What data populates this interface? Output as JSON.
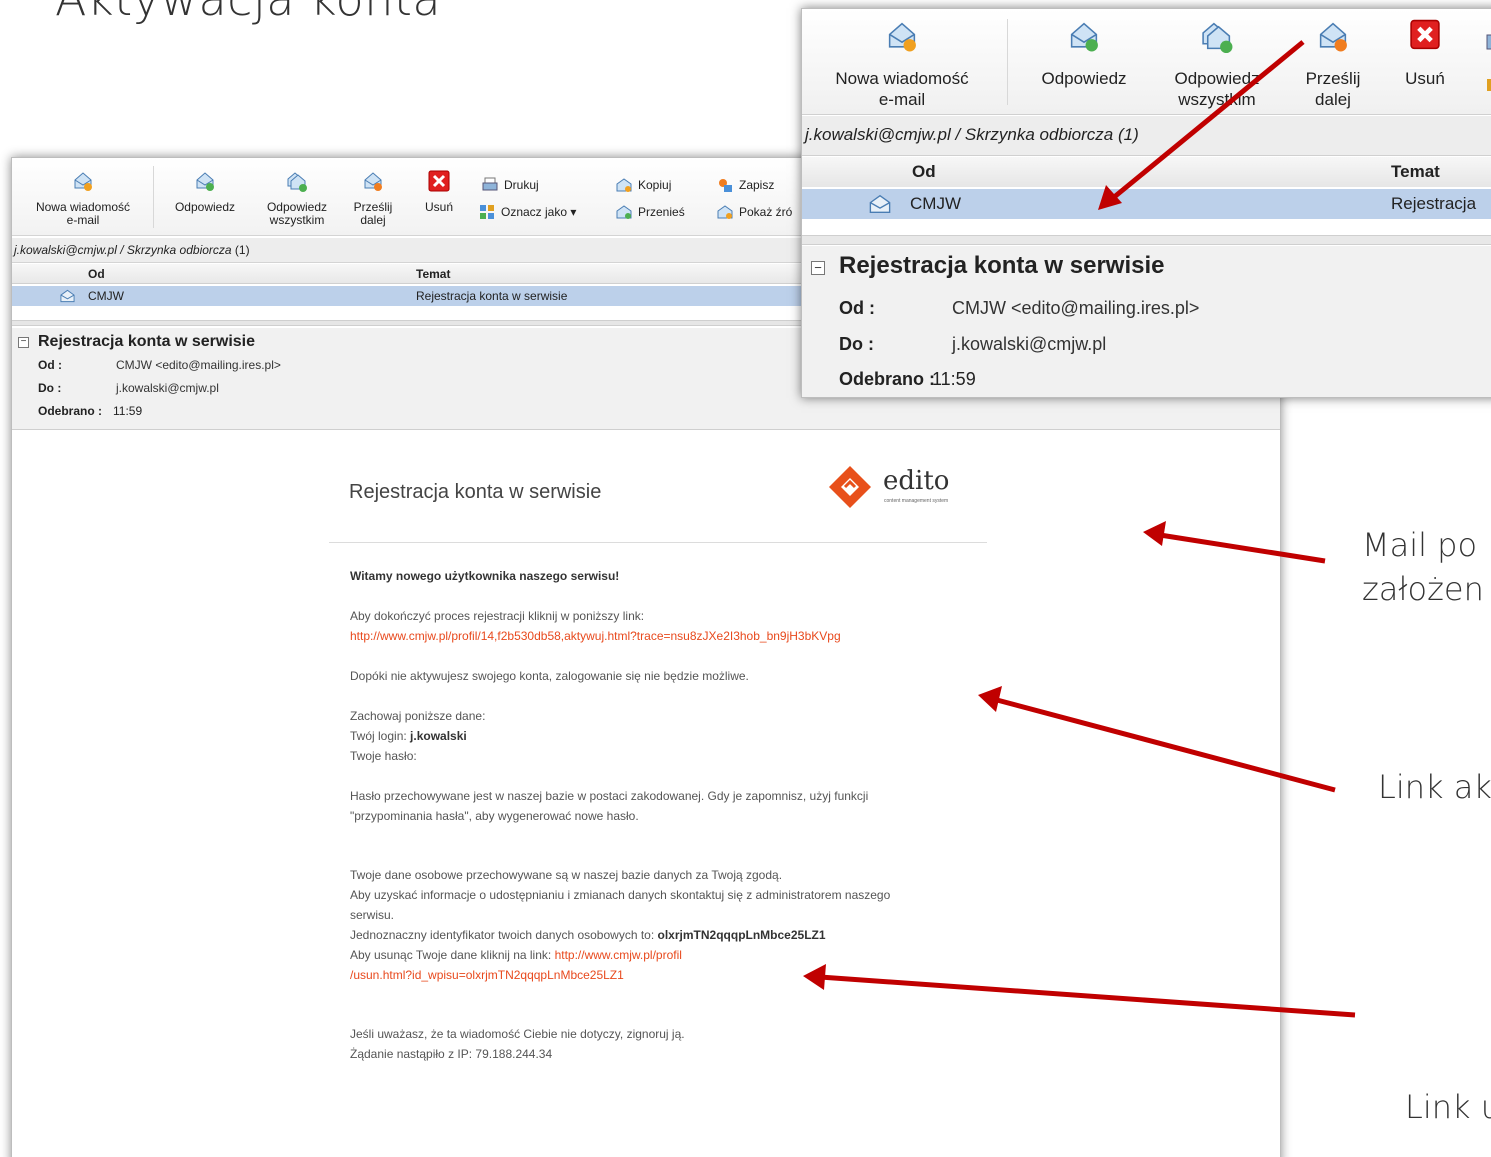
{
  "slide": {
    "title": "Aktywacja konta"
  },
  "toolbar": {
    "new_message": "Nowa wiadomość\ne-mail",
    "reply": "Odpowiedz",
    "reply_all": "Odpowiedz\nwszystkim",
    "forward": "Prześlij\ndalej",
    "delete": "Usuń",
    "print": "Drukuj",
    "mark_as": "Oznacz jako ▾",
    "copy": "Kopiuj",
    "move": "Przenieś",
    "save": "Zapisz",
    "show_source": "Pokaż źró"
  },
  "mailbox": {
    "path_account": "j.kowalski@cmjw.pl / Skrzynka odbiorcza",
    "path_count": " (1)",
    "col_from": "Od",
    "col_subject": "Temat",
    "row_from": "CMJW",
    "row_subject": "Rejestracja konta w serwisie",
    "zoom_row_subject": "Rejestracja"
  },
  "header": {
    "subject": "Rejestracja konta w serwisie",
    "from_label": "Od :",
    "from_value": "CMJW <edito@mailing.ires.pl>",
    "to_label": "Do :",
    "to_value": "j.kowalski@cmjw.pl",
    "received_label": "Odebrano :",
    "received_value": "11:59"
  },
  "email": {
    "title": "Rejestracja konta w serwisie",
    "logo_text": "edito",
    "logo_sub": "content management system",
    "greeting": "Witamy nowego użytkownika naszego serwisu!",
    "finish_text": "Aby dokończyć proces rejestracji kliknij w poniższy link:",
    "activation_link": "http://www.cmjw.pl/profil/14,f2b530db58,aktywuj.html?trace=nsu8zJXe2I3hob_bn9jH3bKVpg",
    "no_login": "Dopóki nie aktywujesz swojego konta, zalogowanie się nie będzie możliwe.",
    "keep_data": "Zachowaj poniższe dane:",
    "login_label": "Twój login: ",
    "login_value": "j.kowalski",
    "password_label": "Twoje hasło:",
    "password_info_1": "Hasło przechowywane jest w naszej bazie w postaci zakodowanej. Gdy je zapomnisz, użyj funkcji",
    "password_info_2": "\"przypominania hasła\", aby wygenerować nowe hasło.",
    "privacy_1": "Twoje dane osobowe przechowywane są w naszej bazie danych za Twoją zgodą.",
    "privacy_2": "Aby uzyskać informacje o udostępnianiu i zmianach danych skontaktuj się z administratorem naszego",
    "privacy_3": "serwisu.",
    "id_label": "Jednoznaczny identyfikator twoich danych osobowych to: ",
    "id_value": "olxrjmTN2qqqpLnMbce25LZ1",
    "remove_label": "Aby usunąc Twoje dane kliknij na link: ",
    "remove_link_1": "http://www.cmjw.pl/profil",
    "remove_link_2": "/usun.html?id_wpisu=olxrjmTN2qqqpLnMbce25LZ1",
    "ignore": "Jeśli uważasz, że ta wiadomość Ciebie nie dotyczy, zignoruj ją.",
    "ip_info": "Żądanie nastąpiło z IP: 79.188.244.34"
  },
  "annotations": {
    "a1_line1": "Mail po",
    "a1_line2": "założen",
    "a2": "Link ak",
    "a3": "Link u"
  },
  "colors": {
    "arrow": "#c00000",
    "link": "#e8491d",
    "selected_row": "#bcd0ea",
    "logo": "#e8501b"
  }
}
